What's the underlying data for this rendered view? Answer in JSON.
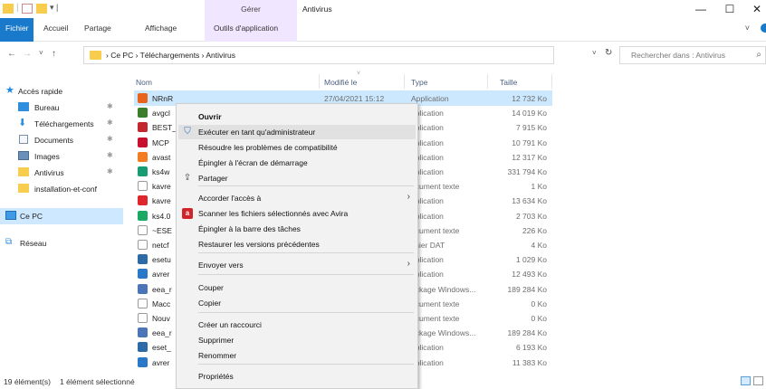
{
  "window": {
    "title": "Antivirus",
    "contextual_group": "Gérer",
    "controls": {
      "minimize": "—",
      "maximize": "☐",
      "close": "✕"
    }
  },
  "ribbon": {
    "tabs": [
      "Fichier",
      "Accueil",
      "Partage",
      "Affichage",
      "Outils d'application"
    ],
    "expand_icon": "chevron-down-icon"
  },
  "address": {
    "back": "←",
    "forward": "→",
    "recent": "˅",
    "up": "↑",
    "breadcrumb": "›  Ce PC  ›  Téléchargements  ›  Antivirus",
    "dropdown": "˅",
    "refresh": "↻"
  },
  "search": {
    "placeholder": "Rechercher dans : Antivirus",
    "icon": "⌕"
  },
  "nav_pane": {
    "items": [
      {
        "label": "Accès rapide",
        "icon": "star-icon",
        "pinned": false
      },
      {
        "label": "Bureau",
        "icon": "desktop-folder-icon",
        "pinned": true
      },
      {
        "label": "Téléchargements",
        "icon": "download-icon",
        "pinned": true
      },
      {
        "label": "Documents",
        "icon": "documents-icon",
        "pinned": true
      },
      {
        "label": "Images",
        "icon": "images-icon",
        "pinned": true
      },
      {
        "label": "Antivirus",
        "icon": "folder-icon",
        "pinned": true
      },
      {
        "label": "installation-et-conf",
        "icon": "folder-icon",
        "pinned": false
      },
      {
        "label": "Ce PC",
        "icon": "computer-icon",
        "pinned": false
      },
      {
        "label": "Réseau",
        "icon": "network-icon",
        "pinned": false
      }
    ],
    "pin_glyph": "✱"
  },
  "columns": {
    "name": "Nom",
    "modified": "Modifié le",
    "type": "Type",
    "size": "Taille"
  },
  "files": [
    {
      "name": "NRnR",
      "modified": "27/04/2021 15:12",
      "type": "Application",
      "size": "12 732 Ko",
      "icon_color": "#e8631c"
    },
    {
      "name": "avgcl",
      "modified": "",
      "type": "pplication",
      "size": "14 019 Ko",
      "icon_color": "#3a7d2c"
    },
    {
      "name": "BEST_",
      "modified": "",
      "type": "pplication",
      "size": "7 915 Ko",
      "icon_color": "#c4262e"
    },
    {
      "name": "MCP",
      "modified": "",
      "type": "pplication",
      "size": "10 791 Ko",
      "icon_color": "#c8102e"
    },
    {
      "name": "avast",
      "modified": "",
      "type": "pplication",
      "size": "12 317 Ko",
      "icon_color": "#f47b20"
    },
    {
      "name": "ks4w",
      "modified": "",
      "type": "pplication",
      "size": "331 794 Ko",
      "icon_color": "#169b72"
    },
    {
      "name": "kavre",
      "modified": "",
      "type": "ocument texte",
      "size": "1 Ko",
      "icon_color": "#ffffff"
    },
    {
      "name": "kavre",
      "modified": "",
      "type": "pplication",
      "size": "13 634 Ko",
      "icon_color": "#e0262d"
    },
    {
      "name": "ks4.0",
      "modified": "",
      "type": "pplication",
      "size": "2 703 Ko",
      "icon_color": "#1aa865"
    },
    {
      "name": "~ESE",
      "modified": "",
      "type": "ocument texte",
      "size": "226 Ko",
      "icon_color": "#ffffff"
    },
    {
      "name": "netcf",
      "modified": "",
      "type": "chier DAT",
      "size": "4 Ko",
      "icon_color": "#ffffff"
    },
    {
      "name": "esetu",
      "modified": "",
      "type": "pplication",
      "size": "1 029 Ko",
      "icon_color": "#2d6aa8"
    },
    {
      "name": "avrer",
      "modified": "",
      "type": "pplication",
      "size": "12 493 Ko",
      "icon_color": "#2a78c8"
    },
    {
      "name": "eea_r",
      "modified": "",
      "type": "ackage Windows...",
      "size": "189 284 Ko",
      "icon_color": "#4a76b8"
    },
    {
      "name": "Macc",
      "modified": "",
      "type": "ocument texte",
      "size": "0 Ko",
      "icon_color": "#ffffff"
    },
    {
      "name": "Nouv",
      "modified": "",
      "type": "ocument texte",
      "size": "0 Ko",
      "icon_color": "#ffffff"
    },
    {
      "name": "eea_r",
      "modified": "",
      "type": "ackage Windows...",
      "size": "189 284 Ko",
      "icon_color": "#4a76b8"
    },
    {
      "name": "eset_",
      "modified": "",
      "type": "pplication",
      "size": "6 193 Ko",
      "icon_color": "#2d6aa8"
    },
    {
      "name": "avrer",
      "modified": "",
      "type": "pplication",
      "size": "11 383 Ko",
      "icon_color": "#2a78c8"
    }
  ],
  "context_menu": {
    "items": [
      {
        "label": "Ouvrir",
        "bold": true,
        "icon": "",
        "submenu": false
      },
      {
        "label": "Exécuter en tant qu'administrateur",
        "bold": false,
        "icon": "shield-icon",
        "submenu": false,
        "highlighted": true
      },
      {
        "label": "Résoudre les problèmes de compatibilité",
        "bold": false,
        "icon": "",
        "submenu": false
      },
      {
        "label": "Épingler à l'écran de démarrage",
        "bold": false,
        "icon": "",
        "submenu": false
      },
      {
        "label": "Partager",
        "bold": false,
        "icon": "share-icon",
        "submenu": false
      },
      {
        "label": "Accorder l'accès à",
        "bold": false,
        "icon": "",
        "submenu": true
      },
      {
        "label": "Scanner les fichiers sélectionnés avec Avira",
        "bold": false,
        "icon": "avira-icon",
        "submenu": false
      },
      {
        "label": "Épingler à la barre des tâches",
        "bold": false,
        "icon": "",
        "submenu": false
      },
      {
        "label": "Restaurer les versions précédentes",
        "bold": false,
        "icon": "",
        "submenu": false
      },
      {
        "label": "Envoyer vers",
        "bold": false,
        "icon": "",
        "submenu": true
      },
      {
        "label": "Couper",
        "bold": false,
        "icon": "",
        "submenu": false
      },
      {
        "label": "Copier",
        "bold": false,
        "icon": "",
        "submenu": false
      },
      {
        "label": "Créer un raccourci",
        "bold": false,
        "icon": "",
        "submenu": false
      },
      {
        "label": "Supprimer",
        "bold": false,
        "icon": "",
        "submenu": false
      },
      {
        "label": "Renommer",
        "bold": false,
        "icon": "",
        "submenu": false
      },
      {
        "label": "Propriétés",
        "bold": false,
        "icon": "",
        "submenu": false
      }
    ],
    "submenu_glyph": "›"
  },
  "status_bar": {
    "count": "19 élément(s)",
    "selection": "1 élément sélectionné"
  },
  "colors": {
    "accent": "#1979ca",
    "selection": "#cce8ff",
    "contextual": "#f1e6ff",
    "folder": "#f8cc4c"
  }
}
